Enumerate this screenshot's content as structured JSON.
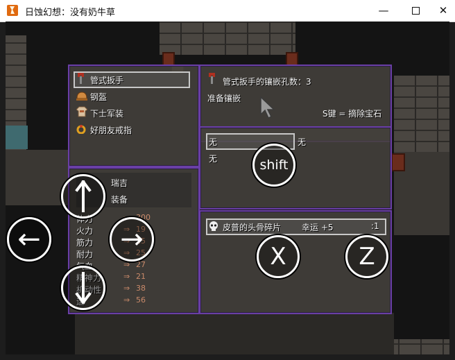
{
  "window": {
    "title": "日蚀幻想：没有奶牛草",
    "minimize_glyph": "—",
    "close_glyph": "✕"
  },
  "equipment": {
    "items": [
      {
        "label": "管式扳手",
        "icon": "wrench-icon",
        "color": "#b03020",
        "selected": true
      },
      {
        "label": "钢盔",
        "icon": "helmet-icon",
        "color": "#d08a40"
      },
      {
        "label": "下士军装",
        "icon": "uniform-icon",
        "color": "#d8c0a0"
      },
      {
        "label": "好朋友戒指",
        "icon": "ring-icon",
        "color": "#e0a020"
      }
    ]
  },
  "character": {
    "name": "瑞吉",
    "command": "装备",
    "stats": [
      {
        "label": "体力",
        "value": "300"
      },
      {
        "label": "火力",
        "value": "19"
      },
      {
        "label": "筋力",
        "value": "15"
      },
      {
        "label": "耐力",
        "value": "25"
      },
      {
        "label": "气血",
        "value": "27"
      },
      {
        "label": "精神力",
        "value": "21"
      },
      {
        "label": "机动性",
        "value": "38"
      },
      {
        "label": "运",
        "value": "56"
      }
    ]
  },
  "socket_info": {
    "title": "管式扳手的镶嵌孔数：3",
    "status": "准备镶嵌",
    "hint": "S键 = 摘除宝石"
  },
  "slots": {
    "slot1": "无",
    "slot1_right": "无",
    "slot2": "无"
  },
  "gems": {
    "item": "皮普的头骨碎片",
    "effect": "幸运 +5",
    "count": ":1"
  },
  "controls": {
    "shift_label": "shift",
    "x_label": "X",
    "z_label": "Z",
    "left_arrow": "←",
    "right_arrow": "→"
  },
  "colors": {
    "panel_border": "#6a3fa6",
    "stat_value": "#c98a6a"
  }
}
